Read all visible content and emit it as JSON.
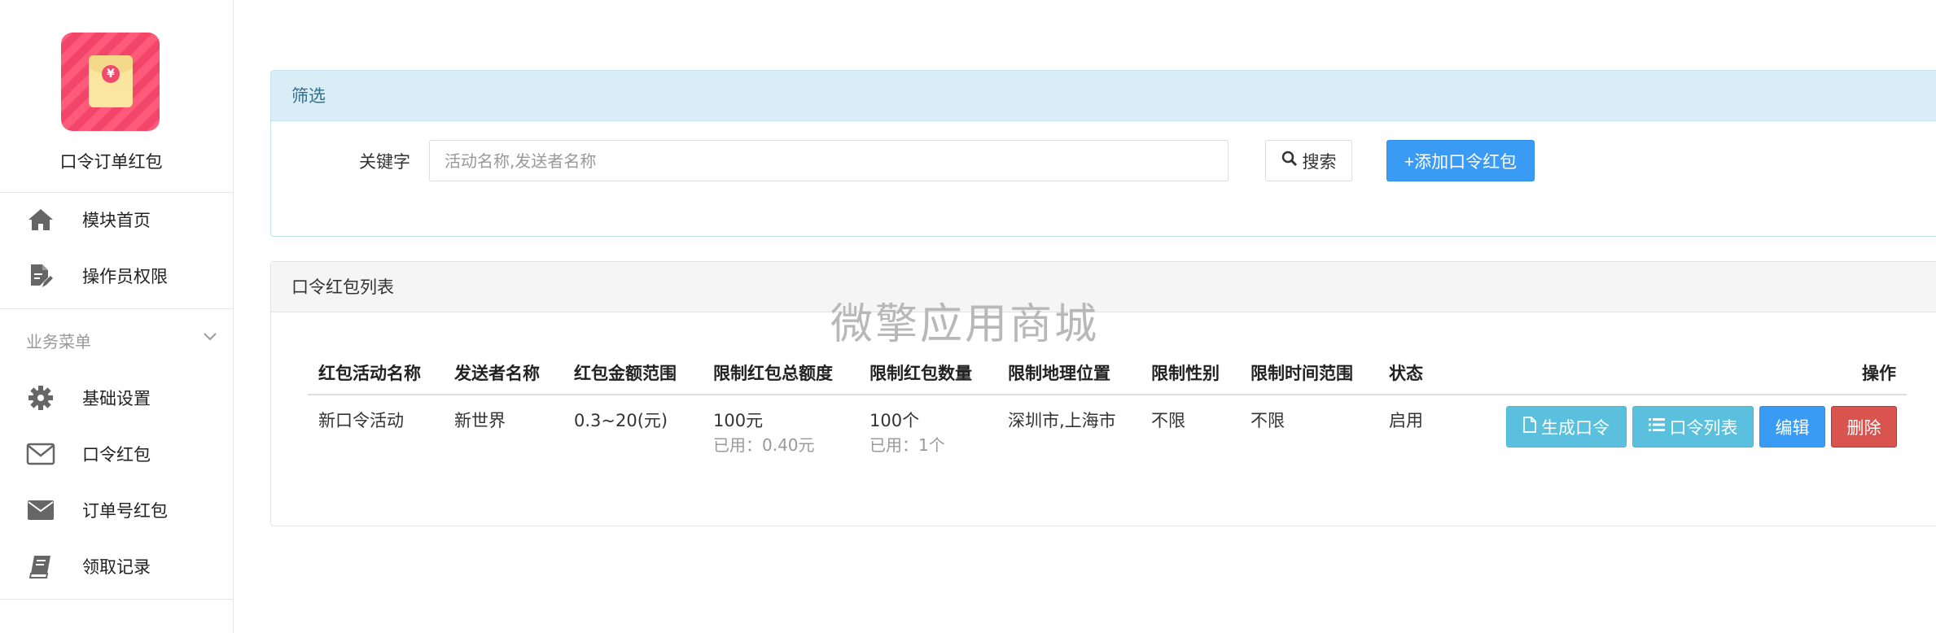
{
  "sidebar": {
    "app_name": "口令订单红包",
    "nav_top": [
      {
        "label": "模块首页",
        "icon": "home-icon"
      },
      {
        "label": "操作员权限",
        "icon": "file-edit-icon"
      }
    ],
    "section_label": "业务菜单",
    "nav_business": [
      {
        "label": "基础设置",
        "icon": "gear-icon"
      },
      {
        "label": "口令红包",
        "icon": "envelope-outline-icon"
      },
      {
        "label": "订单号红包",
        "icon": "envelope-filled-icon"
      },
      {
        "label": "领取记录",
        "icon": "book-icon"
      }
    ]
  },
  "filter": {
    "title": "筛选",
    "keyword_label": "关键字",
    "keyword_placeholder": "活动名称,发送者名称",
    "keyword_value": "",
    "search_label": "搜索",
    "add_label": "+添加口令红包"
  },
  "list": {
    "title": "口令红包列表",
    "columns": [
      "红包活动名称",
      "发送者名称",
      "红包金额范围",
      "限制红包总额度",
      "限制红包数量",
      "限制地理位置",
      "限制性别",
      "限制时间范围",
      "状态",
      "操作"
    ],
    "rows": [
      {
        "name": "新口令活动",
        "sender": "新世界",
        "amount_range": "0.3~20(元)",
        "total_limit": "100元",
        "total_used": "已用：0.40元",
        "count_limit": "100个",
        "count_used": "已用：1个",
        "location": "深圳市,上海市",
        "gender": "不限",
        "time_range": "不限",
        "status": "启用",
        "actions": {
          "generate": "生成口令",
          "list": "口令列表",
          "edit": "编辑",
          "delete": "删除"
        }
      }
    ]
  },
  "watermark": "微擎应用商城",
  "colors": {
    "primary": "#3a9bf4",
    "info": "#5bc0de",
    "danger": "#d9534f",
    "filter_header": "#d9edf7"
  }
}
